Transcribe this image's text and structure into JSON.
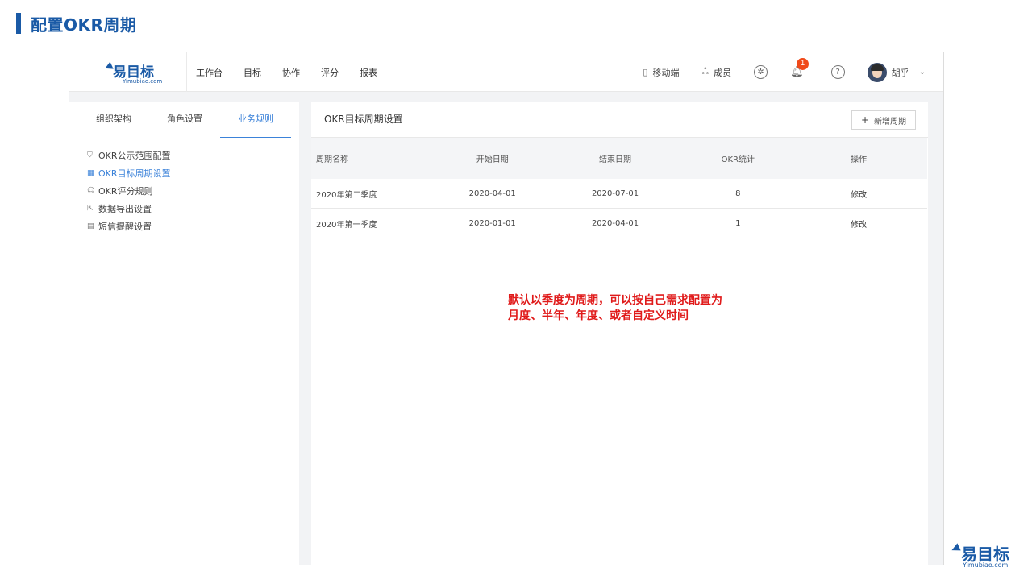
{
  "slide": {
    "title": "配置OKR周期"
  },
  "app": {
    "logo_cn": "易目标",
    "logo_en": "Yimubiao.com",
    "nav": [
      "工作台",
      "目标",
      "协作",
      "评分",
      "报表"
    ],
    "mobile_label": "移动端",
    "members_label": "成员",
    "notification_count": "1",
    "help_icon": "?",
    "user_name": "胡乎",
    "dropdown_arrow": "⌄"
  },
  "left": {
    "tabs": [
      "组织架构",
      "角色设置",
      "业务规则"
    ],
    "active_tab": "业务规则",
    "menu": [
      {
        "label": "OKR公示范围配置",
        "icon": "shield-icon"
      },
      {
        "label": "OKR目标周期设置",
        "icon": "calendar-icon",
        "active": true
      },
      {
        "label": "OKR评分规则",
        "icon": "user-group-icon"
      },
      {
        "label": "数据导出设置",
        "icon": "export-doc-icon"
      },
      {
        "label": "短信提醒设置",
        "icon": "document-icon"
      }
    ]
  },
  "main": {
    "title": "OKR目标周期设置",
    "add_button": "新增周期",
    "columns": [
      "周期名称",
      "开始日期",
      "结束日期",
      "OKR统计",
      "操作"
    ],
    "rows": [
      [
        "2020年第二季度",
        "2020-04-01",
        "2020-07-01",
        "8",
        "修改"
      ],
      [
        "2020年第一季度",
        "2020-01-01",
        "2020-04-01",
        "1",
        "修改"
      ]
    ]
  },
  "note": {
    "line1": "默认以季度为周期，可以按自己需求配置为",
    "line2": "月度、半年、年度、或者自定义时间"
  },
  "colors": {
    "brand": "#1a5aa6",
    "active": "#3b82d9",
    "note": "#e01a1a",
    "badge": "#f04a1a"
  }
}
